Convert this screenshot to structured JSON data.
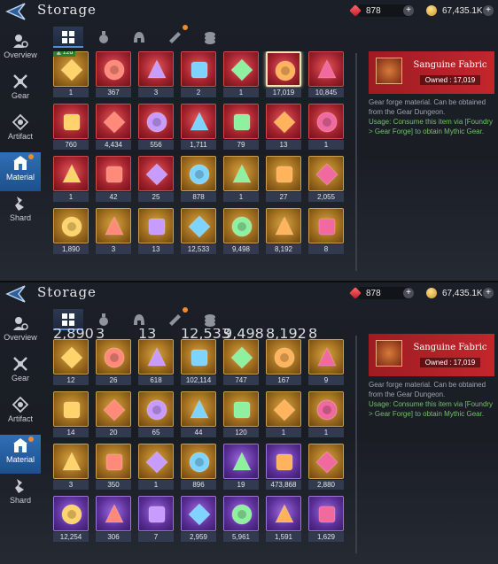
{
  "app": {
    "title": "Storage"
  },
  "currencies": {
    "ruby": "878",
    "gold": "67,435.1K",
    "add_label": "+"
  },
  "sidebar": [
    {
      "label": "Overview",
      "icon": "overview-icon"
    },
    {
      "label": "Gear",
      "icon": "gear-icon"
    },
    {
      "label": "Artifact",
      "icon": "artifact-icon"
    },
    {
      "label": "Material",
      "icon": "material-icon",
      "active": true
    },
    {
      "label": "Shard",
      "icon": "shard-icon"
    }
  ],
  "tabs": [
    "all-tab",
    "potion-tab",
    "helmet-tab",
    "scroll-tab",
    "coins-tab"
  ],
  "detail": {
    "name": "Sanguine Fabric",
    "owned": "Owned : 17,019",
    "desc": "Gear forge material. Can be obtained from the Gear Dungeon.",
    "usage": "Usage: Consume this item via [Foundry > Gear Forge] to obtain Mythic Gear."
  },
  "top_grid": [
    {
      "r": "gold",
      "c": "1",
      "badge": "12d",
      "icon": "map-scroll"
    },
    {
      "r": "red",
      "c": "367",
      "icon": "gold-ore"
    },
    {
      "r": "red",
      "c": "3",
      "icon": "purple-crystal"
    },
    {
      "r": "red",
      "c": "2",
      "icon": "red-hammer"
    },
    {
      "r": "red",
      "c": "1",
      "icon": "dark-orb"
    },
    {
      "r": "red",
      "c": "17,019",
      "icon": "sanguine-fabric",
      "selected": true
    },
    {
      "r": "red",
      "c": "10,845",
      "icon": "fire-ore"
    },
    {
      "r": "red",
      "c": "760",
      "icon": "red-gem"
    },
    {
      "r": "red",
      "c": "4,434",
      "icon": "red-feather"
    },
    {
      "r": "red",
      "c": "556",
      "icon": "red-cube"
    },
    {
      "r": "red",
      "c": "1,711",
      "icon": "red-ring"
    },
    {
      "r": "red",
      "c": "79",
      "icon": "red-amulet"
    },
    {
      "r": "red",
      "c": "13",
      "icon": "purple-emblem"
    },
    {
      "r": "red",
      "c": "1",
      "icon": "blue-crest"
    },
    {
      "r": "red",
      "c": "1",
      "icon": "red-shield"
    },
    {
      "r": "red",
      "c": "42",
      "icon": "red-scroll"
    },
    {
      "r": "red",
      "c": "25",
      "icon": "red-pouch"
    },
    {
      "r": "gold",
      "c": "878",
      "icon": "red-stones"
    },
    {
      "r": "gold",
      "c": "1",
      "icon": "gold-bell"
    },
    {
      "r": "gold",
      "c": "27",
      "icon": "red-brooch"
    },
    {
      "r": "gold",
      "c": "2,055",
      "icon": "blue-card"
    },
    {
      "r": "gold",
      "c": "1,890",
      "icon": "gold-rune"
    },
    {
      "r": "gold",
      "c": "3",
      "icon": "open-book"
    },
    {
      "r": "gold",
      "c": "13",
      "icon": "scale-stack"
    },
    {
      "r": "gold",
      "c": "12,533",
      "icon": "green-crystal"
    },
    {
      "r": "gold",
      "c": "9,498",
      "icon": "blue-crystal"
    },
    {
      "r": "gold",
      "c": "8,192",
      "icon": "red-crystal"
    },
    {
      "r": "gold",
      "c": "8",
      "icon": "gold-hammer"
    }
  ],
  "bottom_partial_counts": [
    "2,890",
    "3",
    "13",
    "12,533",
    "9,498",
    "8,192",
    "8"
  ],
  "bottom_grid": [
    {
      "r": "gold",
      "c": "12",
      "icon": "green-leaf"
    },
    {
      "r": "gold",
      "c": "26",
      "icon": "purple-gem"
    },
    {
      "r": "gold",
      "c": "618",
      "icon": "blue-shard"
    },
    {
      "r": "gold",
      "c": "102,114",
      "icon": "meat"
    },
    {
      "r": "gold",
      "c": "747",
      "icon": "gold-tower"
    },
    {
      "r": "gold",
      "c": "167",
      "icon": "red-flame"
    },
    {
      "r": "gold",
      "c": "9",
      "icon": "red-emblem"
    },
    {
      "r": "gold",
      "c": "14",
      "icon": "red-crest"
    },
    {
      "r": "gold",
      "c": "20",
      "icon": "red-crest-2"
    },
    {
      "r": "gold",
      "c": "65",
      "icon": "fire-orb"
    },
    {
      "r": "gold",
      "c": "44",
      "icon": "red-medal"
    },
    {
      "r": "gold",
      "c": "120",
      "icon": "chest"
    },
    {
      "r": "gold",
      "c": "1",
      "icon": "chest-2"
    },
    {
      "r": "gold",
      "c": "1",
      "icon": "chest-3"
    },
    {
      "r": "gold",
      "c": "3",
      "icon": "silver-chest"
    },
    {
      "r": "gold",
      "c": "350",
      "icon": "gold-scroll"
    },
    {
      "r": "gold",
      "c": "1",
      "icon": "bundle"
    },
    {
      "r": "gold",
      "c": "896",
      "icon": "amber-gem"
    },
    {
      "r": "purple",
      "c": "19",
      "icon": "crossed-swords"
    },
    {
      "r": "purple",
      "c": "473,868",
      "icon": "purple-cluster"
    },
    {
      "r": "gold",
      "c": "2,880",
      "icon": "gold-coin-emblem"
    },
    {
      "r": "purple",
      "c": "12,254",
      "icon": "red-gem-purple"
    },
    {
      "r": "purple",
      "c": "306",
      "icon": "potion"
    },
    {
      "r": "purple",
      "c": "7",
      "icon": "purple-crystal-2"
    },
    {
      "r": "purple",
      "c": "2,959",
      "icon": "gold-triangle"
    },
    {
      "r": "purple",
      "c": "5,961",
      "icon": "gold-ring"
    },
    {
      "r": "purple",
      "c": "1,591",
      "icon": "blue-ring"
    },
    {
      "r": "purple",
      "c": "1,629",
      "icon": "green-ring"
    }
  ]
}
